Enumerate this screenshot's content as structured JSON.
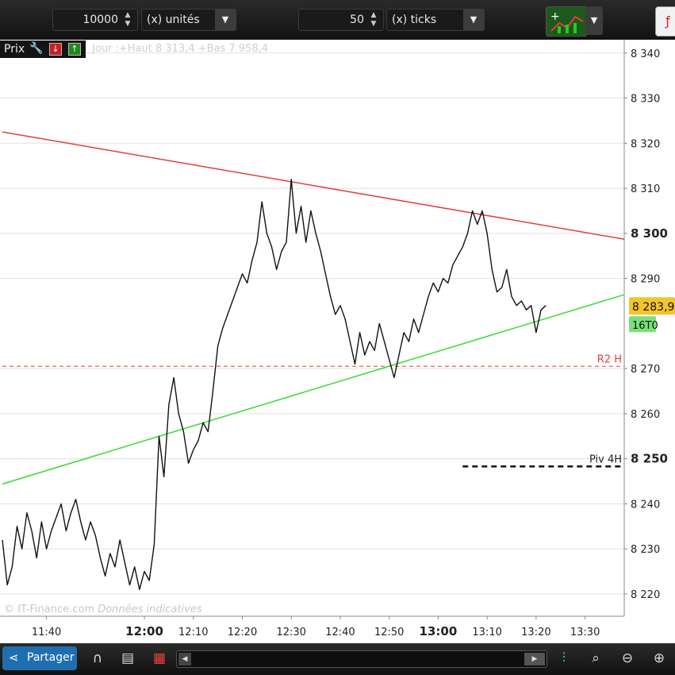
{
  "toolbar": {
    "quantity_value": "10000",
    "quantity_unit": "(x) unités",
    "ticks_value": "50",
    "ticks_unit": "(x) ticks"
  },
  "chart_header": {
    "label": "Prix",
    "info": "Jour :+Haut 8 313,4 +Bas 7 958,4"
  },
  "watermark": {
    "brand": "© IT-Finance.com",
    "note": "Données indicatives"
  },
  "bottombar": {
    "share_label": "Partager"
  },
  "colors": {
    "resistance": "#e0403a",
    "support": "#33dd33",
    "r2_level": "#e0403a",
    "pivot": "#111111",
    "price_badge": "#f2c52c",
    "ticks_badge": "#7be07b"
  },
  "chart_data": {
    "type": "line",
    "ylim": [
      8216,
      8343
    ],
    "y_ticks": [
      {
        "value": 8220,
        "label": "8 220"
      },
      {
        "value": 8230,
        "label": "8 230"
      },
      {
        "value": 8240,
        "label": "8 240"
      },
      {
        "value": 8250,
        "label": "8 250",
        "bold": true
      },
      {
        "value": 8260,
        "label": "8 260"
      },
      {
        "value": 8270,
        "label": "8 270"
      },
      {
        "value": 8290,
        "label": "8 290"
      },
      {
        "value": 8300,
        "label": "8 300",
        "bold": true
      },
      {
        "value": 8310,
        "label": "8 310"
      },
      {
        "value": 8320,
        "label": "8 320"
      },
      {
        "value": 8330,
        "label": "8 330"
      },
      {
        "value": 8340,
        "label": "8 340"
      }
    ],
    "x_ticks": [
      {
        "label": "11:40",
        "bold": false
      },
      {
        "label": "12:00",
        "bold": true
      },
      {
        "label": "12:10",
        "bold": false
      },
      {
        "label": "12:20",
        "bold": false
      },
      {
        "label": "12:30",
        "bold": false
      },
      {
        "label": "12:40",
        "bold": false
      },
      {
        "label": "12:50",
        "bold": false
      },
      {
        "label": "13:00",
        "bold": true
      },
      {
        "label": "13:10",
        "bold": false
      },
      {
        "label": "13:20",
        "bold": false
      },
      {
        "label": "13:30",
        "bold": false
      }
    ],
    "x_range": [
      "11:31",
      "13:38"
    ],
    "series": [
      {
        "color": "#111111",
        "points": [
          [
            "11:31",
            8232
          ],
          [
            "11:32",
            8222
          ],
          [
            "11:33",
            8226
          ],
          [
            "11:34",
            8235
          ],
          [
            "11:35",
            8230
          ],
          [
            "11:36",
            8238
          ],
          [
            "11:37",
            8234
          ],
          [
            "11:38",
            8228
          ],
          [
            "11:39",
            8236
          ],
          [
            "11:40",
            8230
          ],
          [
            "11:41",
            8234
          ],
          [
            "11:42",
            8237
          ],
          [
            "11:43",
            8240
          ],
          [
            "11:44",
            8234
          ],
          [
            "11:45",
            8238
          ],
          [
            "11:46",
            8241
          ],
          [
            "11:47",
            8236
          ],
          [
            "11:48",
            8232
          ],
          [
            "11:49",
            8236
          ],
          [
            "11:50",
            8233
          ],
          [
            "11:51",
            8228
          ],
          [
            "11:52",
            8224
          ],
          [
            "11:53",
            8229
          ],
          [
            "11:54",
            8226
          ],
          [
            "11:55",
            8232
          ],
          [
            "11:56",
            8227
          ],
          [
            "11:57",
            8222
          ],
          [
            "11:58",
            8226
          ],
          [
            "11:59",
            8221
          ],
          [
            "12:00",
            8225
          ],
          [
            "12:01",
            8223
          ],
          [
            "12:02",
            8231
          ],
          [
            "12:03",
            8255
          ],
          [
            "12:04",
            8246
          ],
          [
            "12:05",
            8262
          ],
          [
            "12:06",
            8268
          ],
          [
            "12:07",
            8260
          ],
          [
            "12:08",
            8256
          ],
          [
            "12:09",
            8249
          ],
          [
            "12:10",
            8252
          ],
          [
            "12:11",
            8254
          ],
          [
            "12:12",
            8258
          ],
          [
            "12:13",
            8256
          ],
          [
            "12:14",
            8265
          ],
          [
            "12:15",
            8275
          ],
          [
            "12:16",
            8279
          ],
          [
            "12:17",
            8282
          ],
          [
            "12:18",
            8285
          ],
          [
            "12:19",
            8288
          ],
          [
            "12:20",
            8291
          ],
          [
            "12:21",
            8289
          ],
          [
            "12:22",
            8294
          ],
          [
            "12:23",
            8298
          ],
          [
            "12:24",
            8307
          ],
          [
            "12:25",
            8300
          ],
          [
            "12:26",
            8297
          ],
          [
            "12:27",
            8292
          ],
          [
            "12:28",
            8296
          ],
          [
            "12:29",
            8298
          ],
          [
            "12:30",
            8312
          ],
          [
            "12:31",
            8300
          ],
          [
            "12:32",
            8306
          ],
          [
            "12:33",
            8298
          ],
          [
            "12:34",
            8305
          ],
          [
            "12:35",
            8300
          ],
          [
            "12:36",
            8296
          ],
          [
            "12:37",
            8291
          ],
          [
            "12:38",
            8286
          ],
          [
            "12:39",
            8282
          ],
          [
            "12:40",
            8284
          ],
          [
            "12:41",
            8281
          ],
          [
            "12:42",
            8276
          ],
          [
            "12:43",
            8271
          ],
          [
            "12:44",
            8278
          ],
          [
            "12:45",
            8273
          ],
          [
            "12:46",
            8276
          ],
          [
            "12:47",
            8274
          ],
          [
            "12:48",
            8280
          ],
          [
            "12:49",
            8276
          ],
          [
            "12:50",
            8272
          ],
          [
            "12:51",
            8268
          ],
          [
            "12:52",
            8273
          ],
          [
            "12:53",
            8278
          ],
          [
            "12:54",
            8276
          ],
          [
            "12:55",
            8281
          ],
          [
            "12:56",
            8278
          ],
          [
            "12:57",
            8282
          ],
          [
            "12:58",
            8286
          ],
          [
            "12:59",
            8289
          ],
          [
            "13:00",
            8287
          ],
          [
            "13:01",
            8290
          ],
          [
            "13:02",
            8289
          ],
          [
            "13:03",
            8293
          ],
          [
            "13:04",
            8295
          ],
          [
            "13:05",
            8297
          ],
          [
            "13:06",
            8300
          ],
          [
            "13:07",
            8305
          ],
          [
            "13:08",
            8302
          ],
          [
            "13:09",
            8305
          ],
          [
            "13:10",
            8300
          ],
          [
            "13:11",
            8292
          ],
          [
            "13:12",
            8287
          ],
          [
            "13:13",
            8288
          ],
          [
            "13:14",
            8292
          ],
          [
            "13:15",
            8286
          ],
          [
            "13:16",
            8284
          ],
          [
            "13:17",
            8285
          ],
          [
            "13:18",
            8283
          ],
          [
            "13:19",
            8284
          ],
          [
            "13:20",
            8278
          ],
          [
            "13:21",
            8283
          ],
          [
            "13:22",
            8284
          ]
        ]
      }
    ],
    "trendlines": [
      {
        "name": "resistance",
        "from": [
          "11:31",
          8322.5
        ],
        "to": [
          "13:38",
          8298.7
        ]
      },
      {
        "name": "support",
        "from": [
          "11:31",
          8244.4
        ],
        "to": [
          "13:38",
          8286.4
        ]
      }
    ],
    "levels": [
      {
        "name": "R2 H",
        "value": 8270.5,
        "style": "dashed-red",
        "from": "11:31",
        "to": "13:38"
      },
      {
        "name": "Piv 4H",
        "value": 8248.3,
        "style": "dashed-black",
        "from": "13:05",
        "to": "13:38"
      }
    ],
    "current_price": {
      "value": 8283.9,
      "label": "8 283,9"
    },
    "ticks_badge": {
      "label": "16T",
      "suffix": "0"
    },
    "grid": true
  }
}
